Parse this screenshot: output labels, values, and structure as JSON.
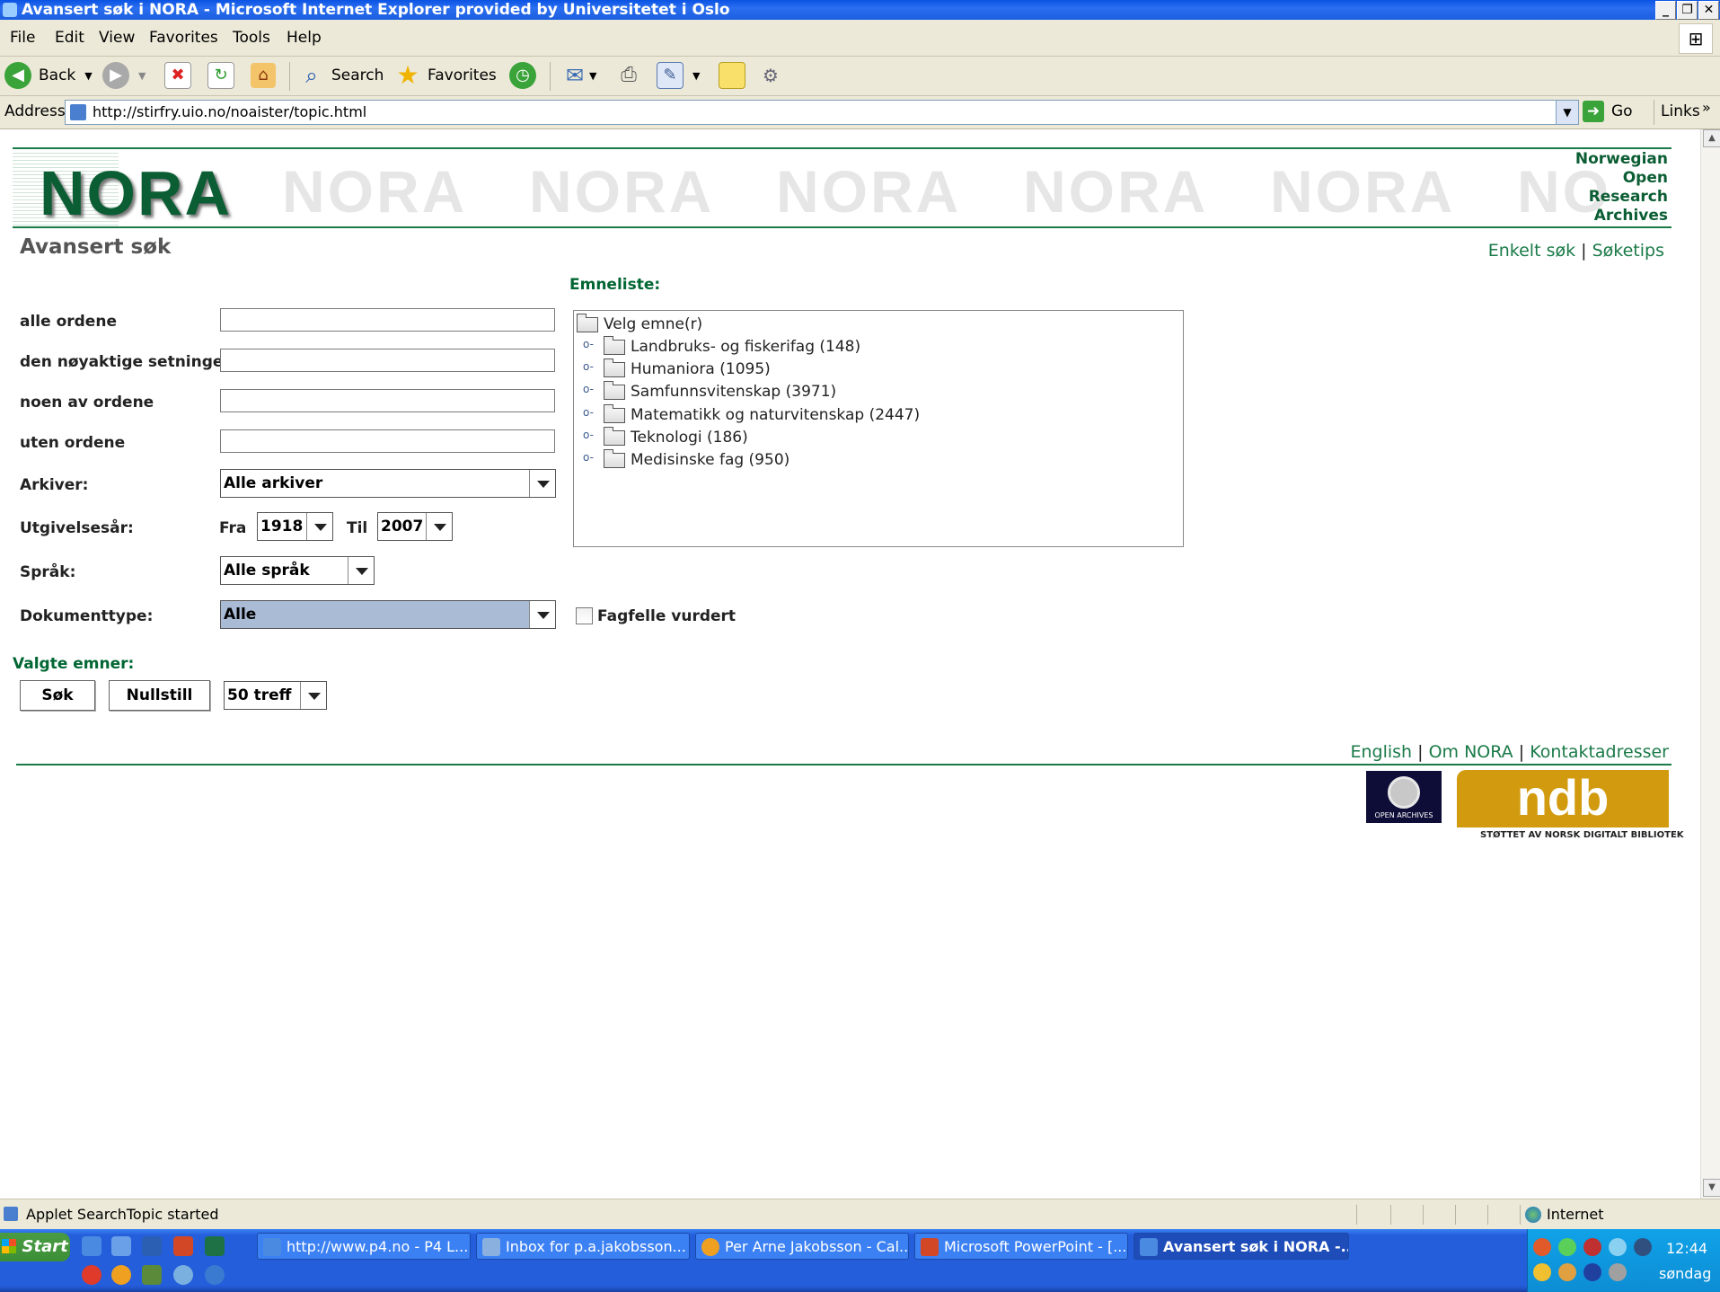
{
  "window": {
    "title": "Avansert søk i NORA - Microsoft Internet Explorer provided by Universitetet i Oslo"
  },
  "menu": [
    "File",
    "Edit",
    "View",
    "Favorites",
    "Tools",
    "Help"
  ],
  "toolbar": {
    "back": "Back",
    "search": "Search",
    "favorites": "Favorites"
  },
  "address": {
    "label": "Address",
    "url": "http://stirfry.uio.no/noaister/topic.html",
    "go": "Go",
    "links": "Links"
  },
  "banner": {
    "logo": "NORA",
    "ghost": [
      "NORA",
      "NORA",
      "NORA",
      "NORA",
      "NORA",
      "NO"
    ],
    "side": [
      "Norwegian",
      "Open",
      "Research",
      "Archives"
    ]
  },
  "page": {
    "title": "Avansert søk",
    "top_links": {
      "simple": "Enkelt søk",
      "sep": "|",
      "tips": "Søketips"
    },
    "form": {
      "all_words": "alle ordene",
      "exact_phrase": "den nøyaktige setningen",
      "any_words": "noen av ordene",
      "without_words": "uten ordene",
      "archives_label": "Arkiver:",
      "archives_value": "Alle arkiver",
      "year_label": "Utgivelsesår:",
      "from_label": "Fra",
      "from_value": "1918",
      "to_label": "Til",
      "to_value": "2007",
      "language_label": "Språk:",
      "language_value": "Alle språk",
      "doctype_label": "Dokumenttype:",
      "doctype_value": "Alle",
      "peer_reviewed": "Fagfelle vurdert",
      "selected_topics": "Valgte emner:",
      "search_button": "Søk",
      "reset_button": "Nullstill",
      "hits_value": "50 treff"
    },
    "topics": {
      "label": "Emneliste:",
      "root": "Velg emne(r)",
      "items": [
        "Landbruks- og fiskerifag (148)",
        "Humaniora (1095)",
        "Samfunnsvitenskap (3971)",
        "Matematikk og naturvitenskap (2447)",
        "Teknologi (186)",
        "Medisinske fag (950)"
      ]
    },
    "footer_links": {
      "english": "English",
      "about": "Om NORA",
      "contacts": "Kontaktadresser",
      "sep": "|"
    },
    "oai_text": "OPEN ARCHIVES",
    "ndb_logo": "ndb",
    "ndb_sub": "STØTTET AV NORSK DIGITALT BIBLIOTEK"
  },
  "status": {
    "text": "Applet SearchTopic started",
    "zone": "Internet"
  },
  "taskbar": {
    "start": "Start",
    "tasks": [
      "http://www.p4.no - P4 L...",
      "Inbox for p.a.jakobsson...",
      "Per Arne Jakobsson - Cal...",
      "Microsoft PowerPoint - [...",
      "Avansert søk i NORA -..."
    ],
    "time": "12:44",
    "day": "søndag"
  },
  "colors": {
    "accent_green": "#0b5d33",
    "link_green": "#1a7a48",
    "xp_blue": "#245edb"
  }
}
